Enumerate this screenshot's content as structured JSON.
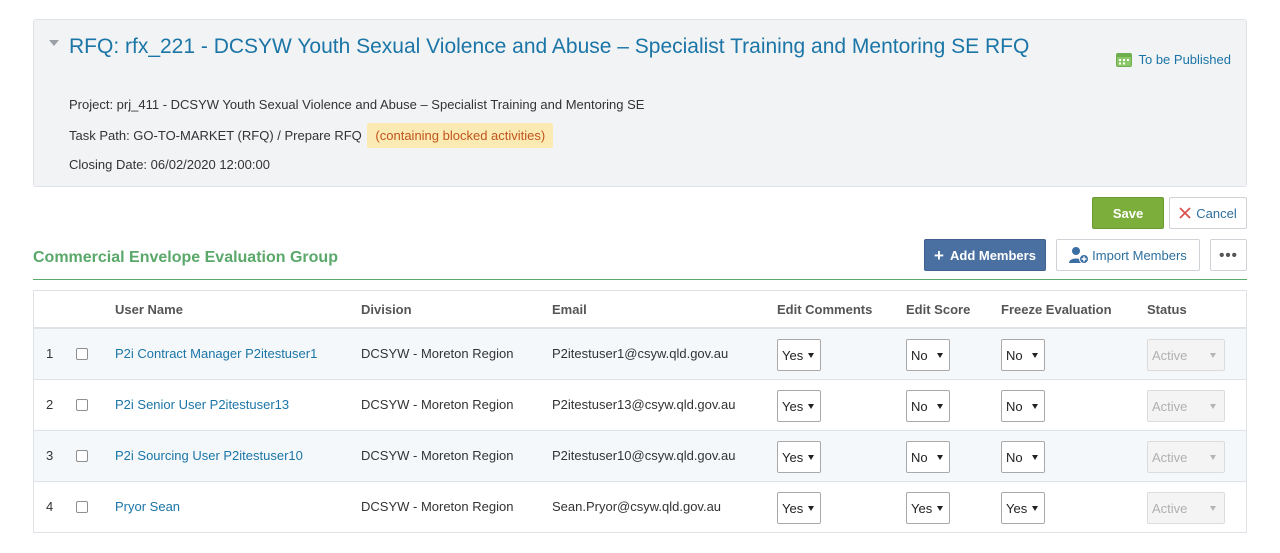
{
  "header": {
    "title": "RFQ: rfx_221 - DCSYW Youth Sexual Violence and Abuse – Specialist Training and Mentoring SE RFQ",
    "status": "To be Published",
    "project": "Project: prj_411 - DCSYW Youth Sexual Violence and Abuse – Specialist Training and Mentoring SE",
    "task_path": "Task Path: GO-TO-MARKET (RFQ) / Prepare RFQ",
    "blocked_note": "(containing blocked activities)",
    "closing_date": "Closing Date: 06/02/2020 12:00:00"
  },
  "actions": {
    "save": "Save",
    "cancel": "Cancel",
    "add_members": "Add Members",
    "import_members": "Import Members",
    "more": "•••"
  },
  "group": {
    "title": "Commercial Envelope Evaluation Group",
    "columns": {
      "user_name": "User Name",
      "division": "Division",
      "email": "Email",
      "edit_comments": "Edit Comments",
      "edit_score": "Edit Score",
      "freeze_evaluation": "Freeze Evaluation",
      "status": "Status"
    },
    "rows": [
      {
        "num": "1",
        "user": "P2i Contract Manager P2itestuser1",
        "division": "DCSYW - Moreton Region",
        "email": "P2itestuser1@csyw.qld.gov.au",
        "edit_comments": "Yes",
        "edit_score": "No",
        "freeze": "No",
        "status": "Active"
      },
      {
        "num": "2",
        "user": "P2i Senior User P2itestuser13",
        "division": "DCSYW - Moreton Region",
        "email": "P2itestuser13@csyw.qld.gov.au",
        "edit_comments": "Yes",
        "edit_score": "No",
        "freeze": "No",
        "status": "Active"
      },
      {
        "num": "3",
        "user": "P2i Sourcing User P2itestuser10",
        "division": "DCSYW - Moreton Region",
        "email": "P2itestuser10@csyw.qld.gov.au",
        "edit_comments": "Yes",
        "edit_score": "No",
        "freeze": "No",
        "status": "Active"
      },
      {
        "num": "4",
        "user": "Pryor Sean",
        "division": "DCSYW - Moreton Region",
        "email": "Sean.Pryor@csyw.qld.gov.au",
        "edit_comments": "Yes",
        "edit_score": "Yes",
        "freeze": "Yes",
        "status": "Active"
      }
    ]
  },
  "colors": {
    "title_blue": "#1b75a6",
    "save_green": "#7cae3c",
    "add_blue": "#4a6fa1",
    "group_green": "#5aa86a",
    "blocked_bg": "#fbeab3",
    "blocked_text": "#c0551d"
  },
  "icons": {
    "collapse": "caret-down-icon",
    "status": "calendar-green-icon",
    "cancel": "close-x-icon",
    "add": "plus-icon",
    "import": "user-add-icon",
    "more": "ellipsis-icon"
  }
}
